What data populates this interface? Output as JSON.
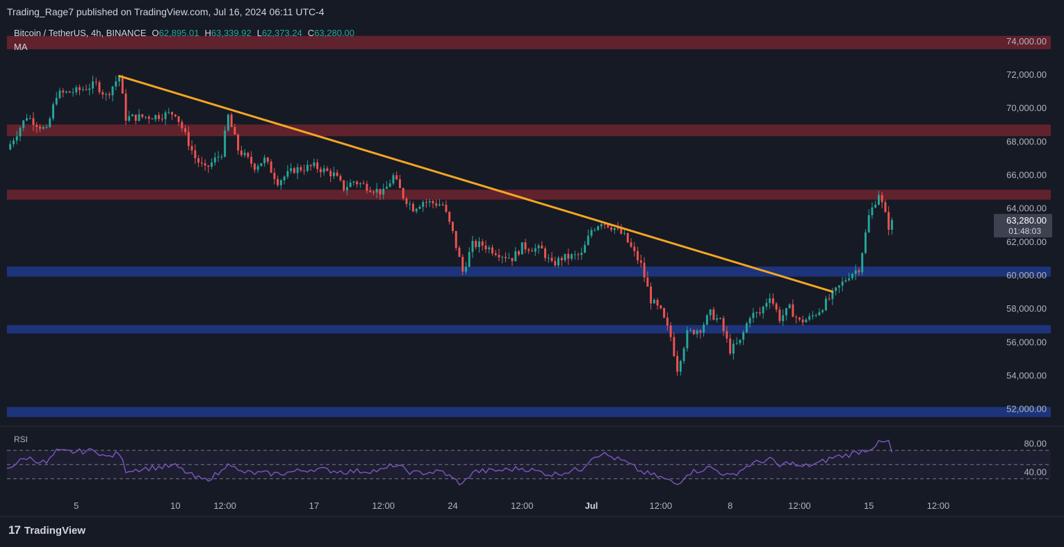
{
  "header": {
    "publisher": "Trading_Rage7 published on TradingView.com, Jul 16, 2024 06:11 UTC-4",
    "symbol": "Bitcoin / TetherUS, 4h, BINANCE",
    "ohlc": [
      {
        "key": "O",
        "value": "62,895.01"
      },
      {
        "key": "H",
        "value": "63,339.92"
      },
      {
        "key": "L",
        "value": "62,373.24"
      },
      {
        "key": "C",
        "value": "63,280.00"
      }
    ],
    "indicator": "MA"
  },
  "price_label": {
    "price": "63,280.00",
    "countdown": "01:48:03"
  },
  "rsi": {
    "label": "RSI",
    "ticks": [
      "80.00",
      "40.00"
    ]
  },
  "brand": {
    "logo": "17",
    "name": "TradingView"
  },
  "colors": {
    "background": "#161a25",
    "up": "#26a69a",
    "down": "#ef5350",
    "resistance_zone": "#7a2530",
    "support_zone": "#1f3a8a",
    "trendline": "#f5a623",
    "rsi_line": "#7e57c2"
  },
  "chart_data": {
    "type": "candlestick",
    "title": "Bitcoin / TetherUS, 4h, BINANCE",
    "y_ticks": [
      74000,
      72000,
      70000,
      68000,
      66000,
      64000,
      62000,
      60000,
      58000,
      56000,
      54000,
      52000
    ],
    "y_tick_labels": [
      "74,000.00",
      "72,000.00",
      "70,000.00",
      "68,000.00",
      "66,000.00",
      "64,000.00",
      "62,000.00",
      "60,000.00",
      "58,000.00",
      "56,000.00",
      "54,000.00",
      "52,000.00"
    ],
    "ylim": [
      51200,
      75200
    ],
    "x_ticks": [
      {
        "label": "5",
        "date": "2024-06-05 00:00"
      },
      {
        "label": "10",
        "date": "2024-06-10 00:00"
      },
      {
        "label": "12:00",
        "date": "2024-06-12 12:00"
      },
      {
        "label": "17",
        "date": "2024-06-17 00:00"
      },
      {
        "label": "12:00",
        "date": "2024-06-20 12:00"
      },
      {
        "label": "24",
        "date": "2024-06-24 00:00"
      },
      {
        "label": "12:00",
        "date": "2024-06-27 12:00"
      },
      {
        "label": "Jul",
        "date": "2024-07-01 00:00",
        "bold": true
      },
      {
        "label": "12:00",
        "date": "2024-07-04 12:00"
      },
      {
        "label": "8",
        "date": "2024-07-08 00:00"
      },
      {
        "label": "12:00",
        "date": "2024-07-11 12:00"
      },
      {
        "label": "15",
        "date": "2024-07-15 00:00"
      },
      {
        "label": "12:00",
        "date": "2024-07-18 12:00"
      }
    ],
    "xlim": [
      "2024-06-01 12:00",
      "2024-07-21 04:00"
    ],
    "candle_interval_hours": 4,
    "zones": [
      {
        "type": "resistance",
        "low": 73500,
        "high": 74300
      },
      {
        "type": "resistance",
        "low": 68300,
        "high": 69000
      },
      {
        "type": "resistance",
        "low": 64500,
        "high": 65100
      },
      {
        "type": "support",
        "low": 59900,
        "high": 60500
      },
      {
        "type": "support",
        "low": 56500,
        "high": 57000
      },
      {
        "type": "support",
        "low": 51500,
        "high": 52100
      }
    ],
    "trendline": {
      "from": {
        "date": "2024-06-07 04:00",
        "price": 71900
      },
      "to": {
        "date": "2024-07-13 04:00",
        "price": 59000
      }
    },
    "price_path": [
      {
        "date": "2024-06-01 12:00",
        "price": 67500
      },
      {
        "date": "2024-06-02 12:00",
        "price": 69500
      },
      {
        "date": "2024-06-03 12:00",
        "price": 68600
      },
      {
        "date": "2024-06-04 00:00",
        "price": 70800
      },
      {
        "date": "2024-06-05 00:00",
        "price": 71000
      },
      {
        "date": "2024-06-06 00:00",
        "price": 71400
      },
      {
        "date": "2024-06-06 12:00",
        "price": 70700
      },
      {
        "date": "2024-06-07 04:00",
        "price": 71900
      },
      {
        "date": "2024-06-07 12:00",
        "price": 69400
      },
      {
        "date": "2024-06-09 00:00",
        "price": 69500
      },
      {
        "date": "2024-06-10 00:00",
        "price": 69700
      },
      {
        "date": "2024-06-11 00:00",
        "price": 67000
      },
      {
        "date": "2024-06-11 12:00",
        "price": 66300
      },
      {
        "date": "2024-06-12 08:00",
        "price": 67300
      },
      {
        "date": "2024-06-12 16:00",
        "price": 69500
      },
      {
        "date": "2024-06-13 04:00",
        "price": 67500
      },
      {
        "date": "2024-06-14 00:00",
        "price": 66500
      },
      {
        "date": "2024-06-14 12:00",
        "price": 66900
      },
      {
        "date": "2024-06-15 04:00",
        "price": 65600
      },
      {
        "date": "2024-06-16 00:00",
        "price": 66300
      },
      {
        "date": "2024-06-17 00:00",
        "price": 66500
      },
      {
        "date": "2024-06-18 00:00",
        "price": 66000
      },
      {
        "date": "2024-06-18 12:00",
        "price": 65200
      },
      {
        "date": "2024-06-19 00:00",
        "price": 65600
      },
      {
        "date": "2024-06-20 12:00",
        "price": 64900
      },
      {
        "date": "2024-06-21 00:00",
        "price": 65900
      },
      {
        "date": "2024-06-21 12:00",
        "price": 64700
      },
      {
        "date": "2024-06-22 00:00",
        "price": 64000
      },
      {
        "date": "2024-06-22 12:00",
        "price": 64400
      },
      {
        "date": "2024-06-23 12:00",
        "price": 64200
      },
      {
        "date": "2024-06-24 00:00",
        "price": 62500
      },
      {
        "date": "2024-06-24 12:00",
        "price": 60200
      },
      {
        "date": "2024-06-25 00:00",
        "price": 61800
      },
      {
        "date": "2024-06-25 12:00",
        "price": 61800
      },
      {
        "date": "2024-06-26 12:00",
        "price": 61200
      },
      {
        "date": "2024-06-27 00:00",
        "price": 61000
      },
      {
        "date": "2024-06-27 12:00",
        "price": 61700
      },
      {
        "date": "2024-06-28 12:00",
        "price": 61500
      },
      {
        "date": "2024-06-29 00:00",
        "price": 60600
      },
      {
        "date": "2024-06-29 12:00",
        "price": 61000
      },
      {
        "date": "2024-06-30 12:00",
        "price": 61200
      },
      {
        "date": "2024-07-01 00:00",
        "price": 62700
      },
      {
        "date": "2024-07-01 12:00",
        "price": 63200
      },
      {
        "date": "2024-07-02 04:00",
        "price": 62800
      },
      {
        "date": "2024-07-02 16:00",
        "price": 62300
      },
      {
        "date": "2024-07-03 12:00",
        "price": 60600
      },
      {
        "date": "2024-07-04 00:00",
        "price": 58500
      },
      {
        "date": "2024-07-04 12:00",
        "price": 57800
      },
      {
        "date": "2024-07-05 00:00",
        "price": 56300
      },
      {
        "date": "2024-07-05 08:00",
        "price": 54400
      },
      {
        "date": "2024-07-05 20:00",
        "price": 56500
      },
      {
        "date": "2024-07-06 12:00",
        "price": 56800
      },
      {
        "date": "2024-07-07 00:00",
        "price": 57700
      },
      {
        "date": "2024-07-07 12:00",
        "price": 57200
      },
      {
        "date": "2024-07-08 00:00",
        "price": 55500
      },
      {
        "date": "2024-07-08 12:00",
        "price": 56000
      },
      {
        "date": "2024-07-09 00:00",
        "price": 57600
      },
      {
        "date": "2024-07-09 12:00",
        "price": 57700
      },
      {
        "date": "2024-07-10 00:00",
        "price": 58800
      },
      {
        "date": "2024-07-10 12:00",
        "price": 57400
      },
      {
        "date": "2024-07-11 00:00",
        "price": 58000
      },
      {
        "date": "2024-07-11 12:00",
        "price": 57200
      },
      {
        "date": "2024-07-12 00:00",
        "price": 57400
      },
      {
        "date": "2024-07-12 12:00",
        "price": 57900
      },
      {
        "date": "2024-07-13 04:00",
        "price": 58800
      },
      {
        "date": "2024-07-14 00:00",
        "price": 60000
      },
      {
        "date": "2024-07-14 12:00",
        "price": 60400
      },
      {
        "date": "2024-07-15 00:00",
        "price": 63500
      },
      {
        "date": "2024-07-15 12:00",
        "price": 64900
      },
      {
        "date": "2024-07-16 00:00",
        "price": 62900
      },
      {
        "date": "2024-07-16 04:00",
        "price": 63280
      }
    ],
    "rsi_ylim": [
      20,
      100
    ],
    "rsi_bands": [
      70,
      50,
      30
    ],
    "rsi_ticks": [
      80,
      40
    ],
    "rsi_path": [
      {
        "date": "2024-06-01 12:00",
        "value": 45
      },
      {
        "date": "2024-06-02 12:00",
        "value": 60
      },
      {
        "date": "2024-06-03 12:00",
        "value": 52
      },
      {
        "date": "2024-06-04 00:00",
        "value": 68
      },
      {
        "date": "2024-06-05 00:00",
        "value": 68
      },
      {
        "date": "2024-06-06 00:00",
        "value": 70
      },
      {
        "date": "2024-06-06 12:00",
        "value": 60
      },
      {
        "date": "2024-06-07 04:00",
        "value": 66
      },
      {
        "date": "2024-06-07 12:00",
        "value": 42
      },
      {
        "date": "2024-06-09 00:00",
        "value": 46
      },
      {
        "date": "2024-06-10 00:00",
        "value": 48
      },
      {
        "date": "2024-06-11 00:00",
        "value": 32
      },
      {
        "date": "2024-06-11 12:00",
        "value": 28
      },
      {
        "date": "2024-06-12 08:00",
        "value": 40
      },
      {
        "date": "2024-06-12 16:00",
        "value": 55
      },
      {
        "date": "2024-06-13 04:00",
        "value": 40
      },
      {
        "date": "2024-06-14 00:00",
        "value": 38
      },
      {
        "date": "2024-06-15 04:00",
        "value": 37
      },
      {
        "date": "2024-06-17 00:00",
        "value": 44
      },
      {
        "date": "2024-06-18 12:00",
        "value": 40
      },
      {
        "date": "2024-06-20 12:00",
        "value": 42
      },
      {
        "date": "2024-06-21 00:00",
        "value": 50
      },
      {
        "date": "2024-06-22 00:00",
        "value": 38
      },
      {
        "date": "2024-06-23 12:00",
        "value": 40
      },
      {
        "date": "2024-06-24 00:00",
        "value": 30
      },
      {
        "date": "2024-06-24 12:00",
        "value": 22
      },
      {
        "date": "2024-06-25 00:00",
        "value": 40
      },
      {
        "date": "2024-06-26 12:00",
        "value": 42
      },
      {
        "date": "2024-06-27 12:00",
        "value": 45
      },
      {
        "date": "2024-06-29 00:00",
        "value": 36
      },
      {
        "date": "2024-06-30 12:00",
        "value": 44
      },
      {
        "date": "2024-07-01 00:00",
        "value": 60
      },
      {
        "date": "2024-07-01 12:00",
        "value": 66
      },
      {
        "date": "2024-07-02 16:00",
        "value": 54
      },
      {
        "date": "2024-07-03 12:00",
        "value": 40
      },
      {
        "date": "2024-07-04 12:00",
        "value": 32
      },
      {
        "date": "2024-07-05 08:00",
        "value": 22
      },
      {
        "date": "2024-07-05 20:00",
        "value": 38
      },
      {
        "date": "2024-07-07 00:00",
        "value": 46
      },
      {
        "date": "2024-07-08 00:00",
        "value": 33
      },
      {
        "date": "2024-07-09 00:00",
        "value": 50
      },
      {
        "date": "2024-07-10 00:00",
        "value": 58
      },
      {
        "date": "2024-07-10 12:00",
        "value": 47
      },
      {
        "date": "2024-07-11 00:00",
        "value": 54
      },
      {
        "date": "2024-07-11 12:00",
        "value": 46
      },
      {
        "date": "2024-07-12 12:00",
        "value": 52
      },
      {
        "date": "2024-07-13 04:00",
        "value": 60
      },
      {
        "date": "2024-07-14 00:00",
        "value": 64
      },
      {
        "date": "2024-07-15 00:00",
        "value": 72
      },
      {
        "date": "2024-07-15 12:00",
        "value": 80
      },
      {
        "date": "2024-07-16 00:00",
        "value": 82
      },
      {
        "date": "2024-07-16 04:00",
        "value": 66
      }
    ]
  }
}
